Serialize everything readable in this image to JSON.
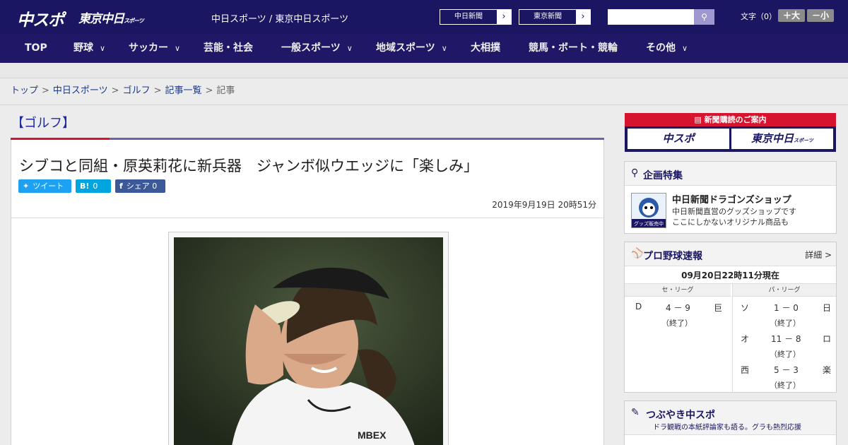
{
  "header": {
    "logo_chuspo": "中スポ",
    "logo_tokyo": "東京中日",
    "logo_tokyo_small": "スポーツ",
    "site_title": "中日スポーツ / 東京中日スポーツ",
    "newspaper_links": [
      "中日新聞",
      "東京新聞"
    ],
    "search": {
      "placeholder": "",
      "button_icon": "search-icon"
    },
    "font_size_label": "文字（0）",
    "font_bigger": "＋大",
    "font_smaller": "－小"
  },
  "nav": {
    "items": [
      {
        "label": "TOP",
        "has_dropdown": false
      },
      {
        "label": "野球",
        "has_dropdown": true
      },
      {
        "label": "サッカー",
        "has_dropdown": true
      },
      {
        "label": "芸能・社会",
        "has_dropdown": false
      },
      {
        "label": "一般スポーツ",
        "has_dropdown": true
      },
      {
        "label": "地域スポーツ",
        "has_dropdown": true
      },
      {
        "label": "大相撲",
        "has_dropdown": false
      },
      {
        "label": "競馬・ボート・競輪",
        "has_dropdown": false
      },
      {
        "label": "その他",
        "has_dropdown": true
      }
    ]
  },
  "breadcrumb": {
    "items": [
      "トップ",
      "中日スポーツ",
      "ゴルフ",
      "記事一覧",
      "記事"
    ],
    "separator": ">"
  },
  "article": {
    "category": "【ゴルフ】",
    "headline": "シブコと同組・原英莉花に新兵器　ジャンボ似ウエッジに「楽しみ」",
    "share": {
      "tweet_label": "ツイート",
      "hatena_label": "B!",
      "hatena_count": "0",
      "facebook_label": "シェア",
      "facebook_count": "0"
    },
    "date": "2019年9月19日 20時51分",
    "photo_caption_visible": "MBEX"
  },
  "sidebar": {
    "subscribe": {
      "header": "新聞購読のご案内",
      "logo_chuspo": "中スポ",
      "logo_tokyo": "東京中日",
      "logo_tokyo_small": "スポーツ"
    },
    "feature": {
      "title": "企画特集",
      "item_title": "中日新聞ドラゴンズショップ",
      "item_desc_1": "中日新聞直営のグッズショップです",
      "item_desc_2": "ここにしかないオリジナル商品も",
      "thumb_text": "グッズ販売中"
    },
    "baseball": {
      "title": "プロ野球速報",
      "more": "詳細 >",
      "time": "09月20日22時11分現在",
      "central_label": "セ・リーグ",
      "pacific_label": "パ・リーグ",
      "central_games": [
        {
          "home": "D",
          "score": "4 － 9",
          "away": "巨",
          "status": "（終了）"
        }
      ],
      "pacific_games": [
        {
          "home": "ソ",
          "score": "1 － 0",
          "away": "日",
          "status": "（終了）"
        },
        {
          "home": "オ",
          "score": "11 － 8",
          "away": "ロ",
          "status": "（終了）"
        },
        {
          "home": "西",
          "score": "5 － 3",
          "away": "楽",
          "status": "（終了）"
        }
      ]
    },
    "tweet": {
      "title": "つぶやき中スポ",
      "subtitle": "ドラ観戦の本紙評論家も語る。グラも熱烈応援"
    }
  },
  "colors": {
    "header_bg": "#1a1662",
    "nav_bg": "#201866",
    "accent_red": "#d6142f",
    "twitter": "#1da1f2",
    "hatena": "#00a4de",
    "facebook": "#3b5998"
  }
}
